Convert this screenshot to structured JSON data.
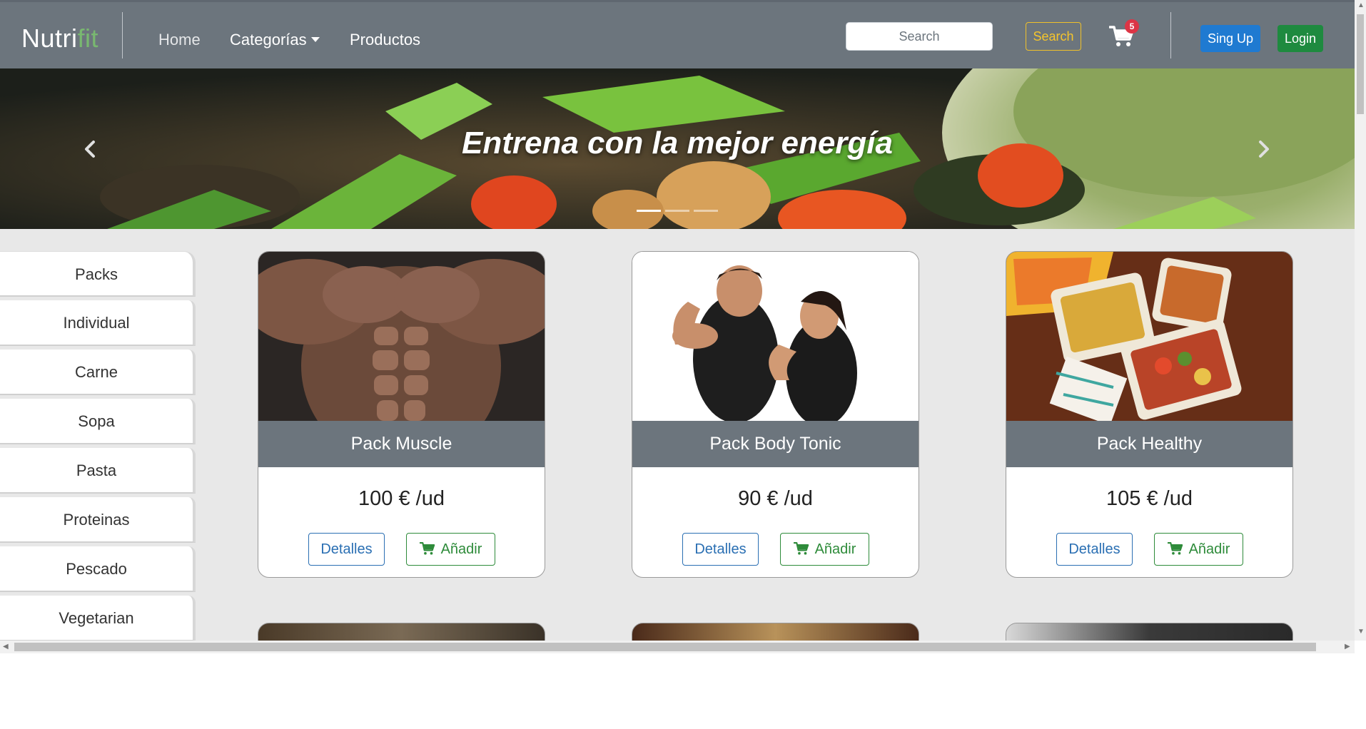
{
  "navbar": {
    "brand_part1": "Nutri",
    "brand_part2": "fit",
    "links": [
      "Home",
      "Categorías",
      "Productos"
    ],
    "search_placeholder": "Search",
    "search_button": "Search",
    "cart_count": "5",
    "signup_label": "Sing Up",
    "login_label": "Login"
  },
  "hero": {
    "title": "Entrena con la mejor energía",
    "slides_count": 3,
    "active_slide": 1
  },
  "sidebar": {
    "items": [
      "Packs",
      "Individual",
      "Carne",
      "Sopa",
      "Pasta",
      "Proteinas",
      "Pescado",
      "Vegetarian"
    ]
  },
  "products": [
    {
      "name": "Pack Muscle",
      "price": "100 € /ud",
      "details_label": "Detalles",
      "add_label": "Añadir"
    },
    {
      "name": "Pack Body Tonic",
      "price": "90 € /ud",
      "details_label": "Detalles",
      "add_label": "Añadir"
    },
    {
      "name": "Pack Healthy",
      "price": "105 € /ud",
      "details_label": "Detalles",
      "add_label": "Añadir"
    }
  ],
  "colors": {
    "navbar": "#6c757d",
    "brand_accent": "#79b870",
    "search_button": "#f5c52c",
    "signup": "#1f7ad1",
    "login": "#1e8a3f",
    "badge": "#dc3545",
    "details": "#2a6fb3",
    "add": "#2e8b3a"
  }
}
